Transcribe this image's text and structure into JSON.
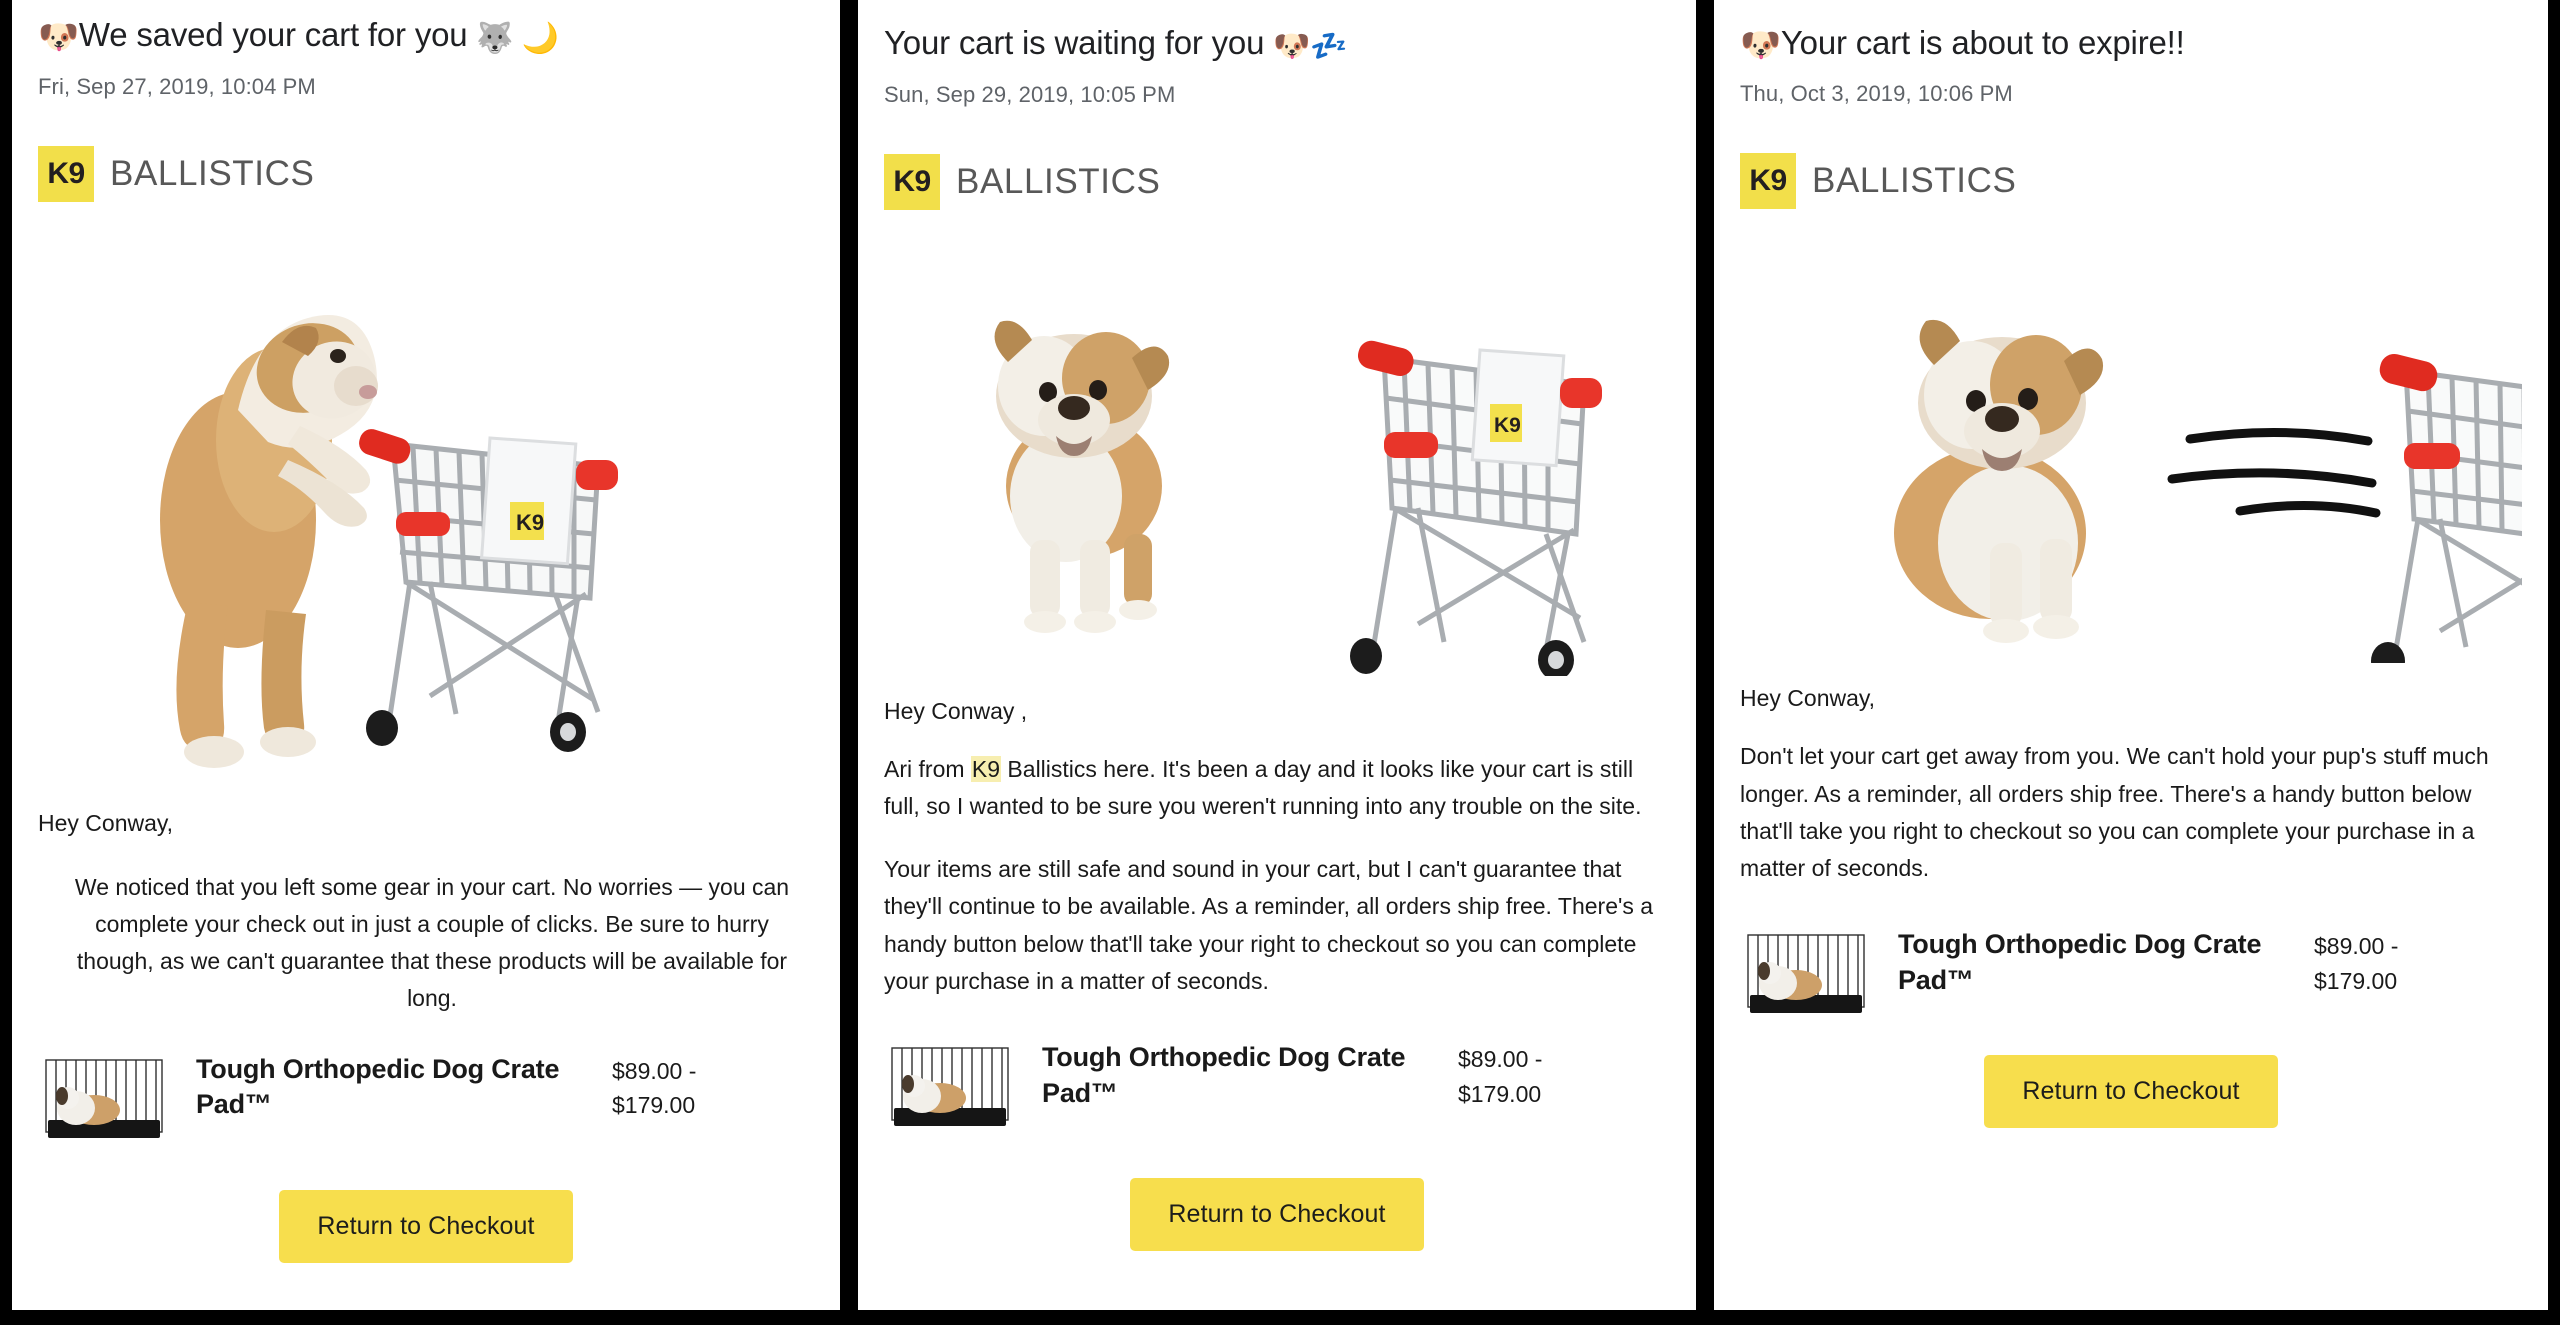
{
  "brand": {
    "mark": "K9",
    "name": "BALLISTICS",
    "mark_bg": "#f2df4a",
    "name_color": "#585858"
  },
  "cta_color": "#f7de4d",
  "emails": [
    {
      "subject_prefix_emoji": "🐶",
      "subject": "We saved your cart for you",
      "subject_suffix_emojis": "🐺 🌙",
      "date": "Fri, Sep 27, 2019, 10:04 PM",
      "greeting": "Hey Conway,",
      "paragraphs": [
        "We noticed that you left some gear in your cart. No worries — you can complete your check out in just a couple of clicks. Be sure to hurry though, as we can't guarantee that these products will be available for long."
      ],
      "product": {
        "title": "Tough Orthopedic Dog Crate Pad™",
        "price_line_1": "$89.00 -",
        "price_line_2": "$179.00",
        "image_alt": "dog-in-crate-on-pad"
      },
      "cta_label": "Return to Checkout",
      "hero_alt": "bulldog-pushing-shopping-cart"
    },
    {
      "subject_prefix_emoji": "",
      "subject": "Your cart is waiting for you",
      "subject_suffix_emojis": "🐶💤",
      "date": "Sun, Sep 29, 2019, 10:05 PM",
      "greeting": "Hey Conway ,",
      "paragraphs": [
        "Ari from K9 Ballistics here. It's been a day and it looks like your cart is still full, so I wanted to be sure you weren't running into any trouble on the site.",
        "Your items are still safe and sound in your cart, but I can't guarantee that they'll continue to be available. As a reminder, all orders ship free. There's a handy button below that'll take your right to checkout so you can complete your purchase in a matter of seconds."
      ],
      "highlight_word": "K9",
      "product": {
        "title": "Tough Orthopedic Dog Crate Pad™",
        "price_line_1": "$89.00 -",
        "price_line_2": "$179.00",
        "image_alt": "dog-in-crate-on-pad"
      },
      "cta_label": "Return to Checkout",
      "hero_alt": "bulldog-standing-next-to-shopping-cart"
    },
    {
      "subject_prefix_emoji": "🐶",
      "subject": "Your cart is about to expire!!",
      "subject_suffix_emojis": "",
      "date": "Thu, Oct 3, 2019, 10:06 PM",
      "greeting": "Hey Conway,",
      "paragraphs": [
        "Don't let your cart get away from you. We can't hold your pup's stuff much longer. As a reminder, all orders ship free. There's a handy button below that'll take you right to checkout so you can complete your purchase in a matter of seconds."
      ],
      "product": {
        "title": "Tough Orthopedic Dog Crate Pad™",
        "price_line_1": "$89.00 -",
        "price_line_2": "$179.00",
        "image_alt": "dog-in-crate-on-pad"
      },
      "cta_label": "Return to Checkout",
      "hero_alt": "bulldog-watching-cart-speed-away"
    }
  ]
}
